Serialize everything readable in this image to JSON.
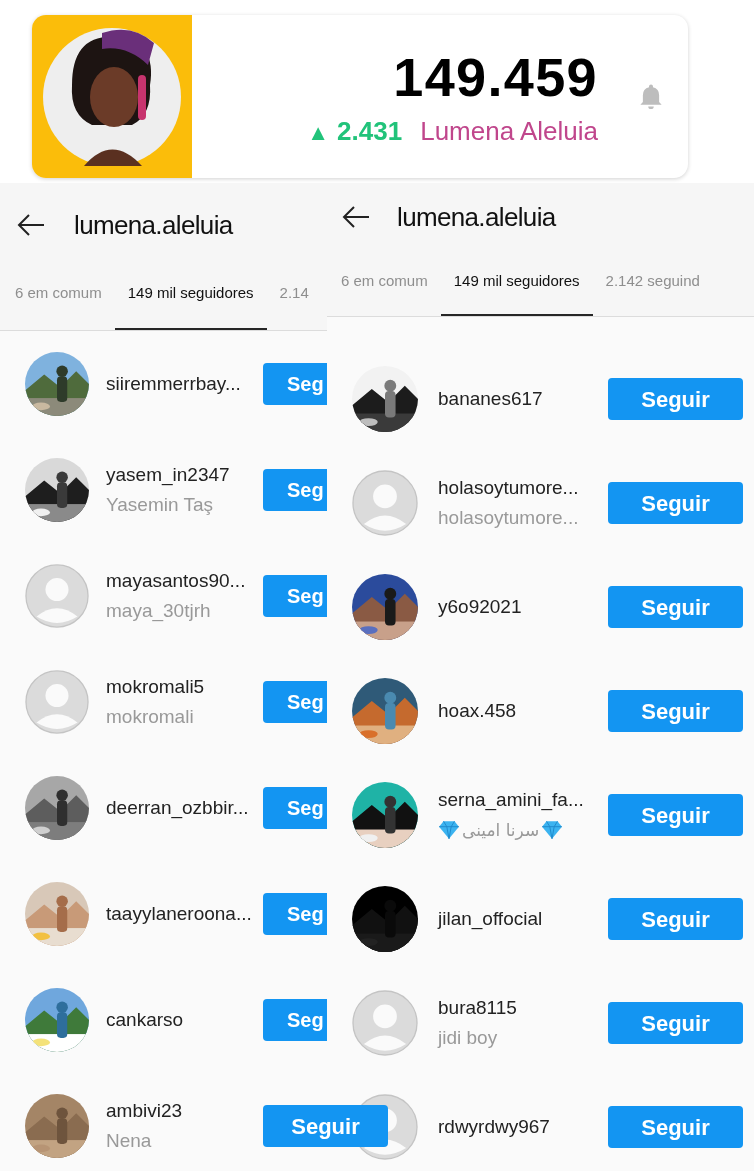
{
  "stats_card": {
    "count": "149.459",
    "change_arrow": "▲",
    "change": "2.431",
    "name": "Lumena Aleluia"
  },
  "panels": [
    {
      "title": "lumena.aleluia",
      "tabs": [
        {
          "label": "6 em comum",
          "selected": false
        },
        {
          "label": "149 mil seguidores",
          "selected": true
        },
        {
          "label": "2.14",
          "selected": false
        }
      ],
      "rows": [
        {
          "username": "siiremmerrbay...",
          "button": "Seg",
          "button_cut": true
        },
        {
          "username": "yasem_in2347",
          "display_name": "Yasemin Taş",
          "button": "Seg",
          "button_cut": true
        },
        {
          "username": "mayasantos90...",
          "display_name": "maya_30tjrh",
          "kind": "default",
          "button": "Seg",
          "button_cut": true
        },
        {
          "username": "mokromali5",
          "display_name": "mokromali",
          "kind": "default",
          "button": "Seg",
          "button_cut": true
        },
        {
          "username": "deerran_ozbbir...",
          "button": "Seg",
          "button_cut": true
        },
        {
          "username": "taayylaneroona...",
          "button": "Seg",
          "button_cut": true
        },
        {
          "username": "cankarso",
          "button": "Seg",
          "button_cut": true
        },
        {
          "username": "ambivi23",
          "display_name": "Nena",
          "button": "Seguir",
          "button_cut": false
        }
      ]
    },
    {
      "title": "lumena.aleluia",
      "tabs": [
        {
          "label": "6 em comum",
          "selected": false
        },
        {
          "label": "149 mil seguidores",
          "selected": true
        },
        {
          "label": "2.142 seguind",
          "selected": false
        }
      ],
      "rows": [
        {
          "username": "bananes617",
          "button": "Seguir",
          "button_cut": false
        },
        {
          "username": "holasoytumore...",
          "display_name": "holasoytumore...",
          "kind": "default",
          "button": "Seguir",
          "button_cut": false
        },
        {
          "username": "y6o92021",
          "button": "Seguir",
          "button_cut": false
        },
        {
          "username": "hoax.458",
          "button": "Seguir",
          "button_cut": false
        },
        {
          "username": "serna_amini_fa...",
          "display_name": "سرنا امینی",
          "diamond_emojis": true,
          "button": "Seguir",
          "button_cut": false
        },
        {
          "username": "jilan_offocial",
          "button": "Seguir",
          "button_cut": false
        },
        {
          "username": "bura8115",
          "display_name": "jidi boy",
          "kind": "default",
          "button": "Seguir",
          "button_cut": false
        },
        {
          "username": "rdwyrdwy967",
          "kind": "default",
          "button": "Seguir",
          "button_cut": false
        }
      ]
    }
  ]
}
